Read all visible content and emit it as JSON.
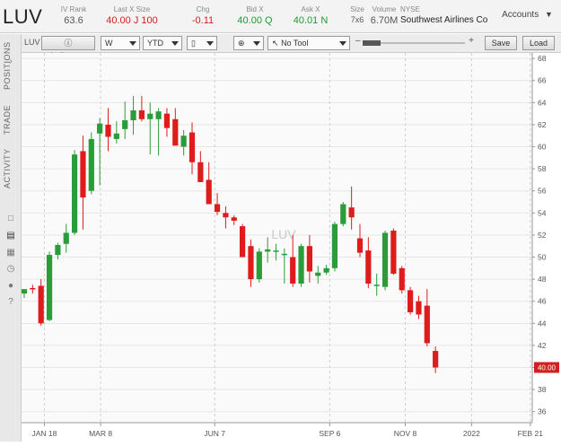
{
  "header": {
    "symbol": "LUV",
    "ivrank_label": "IV Rank",
    "ivrank_value": "63.6",
    "lastx_label": "Last X Size",
    "lastx_value": "40.00 J 100",
    "chg_label": "Chg",
    "chg_value": "-0.11",
    "bidx_label": "Bid X",
    "bidx_value": "40.00 Q",
    "askx_label": "Ask X",
    "askx_value": "40.01 N",
    "size_label": "Size",
    "size_value": "7x6",
    "volume_label": "Volume",
    "volume_value": "6.70M",
    "exchange": "NYSE",
    "company": "Southwest Airlines Co",
    "accounts_label": "Accounts"
  },
  "toolbar": {
    "symbol_label": "LUV",
    "indicators_label": "Indicators",
    "period": "W",
    "range": "YTD",
    "tool": "No Tool",
    "save_label": "Save",
    "load_label": "Load"
  },
  "sidebar": {
    "tabs": [
      "POSITIONS",
      "TRADE",
      "ACTIVITY"
    ]
  },
  "chart_data": {
    "type": "candlestick",
    "watermark": "LUV",
    "ylim": [
      35,
      68.5
    ],
    "yticks": [
      36,
      38,
      40,
      42,
      44,
      46,
      48,
      50,
      52,
      54,
      56,
      58,
      60,
      62,
      64,
      66,
      68
    ],
    "xticks": [
      "JAN 18",
      "MAR 8",
      "JUN 7",
      "SEP 6",
      "NOV 8",
      "2022",
      "FEB 21"
    ],
    "last_price_label": "40.00",
    "colors": {
      "up": "#2a9d3a",
      "down": "#e01b1b",
      "grid": "#e6e6e6"
    },
    "candles": [
      {
        "o": 46.7,
        "h": 47.1,
        "l": 46.3,
        "c": 47.1
      },
      {
        "o": 47.2,
        "h": 47.5,
        "l": 46.7,
        "c": 47.1
      },
      {
        "o": 47.4,
        "h": 48.0,
        "l": 43.8,
        "c": 44.0
      },
      {
        "o": 44.3,
        "h": 50.5,
        "l": 44.2,
        "c": 50.2
      },
      {
        "o": 50.2,
        "h": 51.3,
        "l": 49.8,
        "c": 51.1
      },
      {
        "o": 51.2,
        "h": 53.0,
        "l": 50.4,
        "c": 52.2
      },
      {
        "o": 52.2,
        "h": 59.7,
        "l": 52.0,
        "c": 59.3
      },
      {
        "o": 59.6,
        "h": 61.0,
        "l": 52.5,
        "c": 55.4
      },
      {
        "o": 56.0,
        "h": 61.3,
        "l": 55.7,
        "c": 60.7
      },
      {
        "o": 61.2,
        "h": 62.6,
        "l": 56.5,
        "c": 62.1
      },
      {
        "o": 62.0,
        "h": 63.5,
        "l": 59.6,
        "c": 60.9
      },
      {
        "o": 60.7,
        "h": 62.3,
        "l": 60.3,
        "c": 61.2
      },
      {
        "o": 61.6,
        "h": 64.1,
        "l": 60.7,
        "c": 62.4
      },
      {
        "o": 62.4,
        "h": 64.6,
        "l": 61.1,
        "c": 63.3
      },
      {
        "o": 63.3,
        "h": 64.6,
        "l": 62.3,
        "c": 62.5
      },
      {
        "o": 62.5,
        "h": 64.0,
        "l": 59.3,
        "c": 63.0
      },
      {
        "o": 62.5,
        "h": 63.5,
        "l": 59.2,
        "c": 63.2
      },
      {
        "o": 63.0,
        "h": 63.5,
        "l": 60.9,
        "c": 61.7
      },
      {
        "o": 62.5,
        "h": 63.5,
        "l": 60.3,
        "c": 60.1
      },
      {
        "o": 60.0,
        "h": 61.5,
        "l": 59.2,
        "c": 61.0
      },
      {
        "o": 61.3,
        "h": 62.2,
        "l": 57.5,
        "c": 58.6
      },
      {
        "o": 58.6,
        "h": 59.6,
        "l": 56.8,
        "c": 56.8
      },
      {
        "o": 57.0,
        "h": 58.6,
        "l": 54.8,
        "c": 54.8
      },
      {
        "o": 54.8,
        "h": 55.8,
        "l": 53.8,
        "c": 54.1
      },
      {
        "o": 54.0,
        "h": 54.6,
        "l": 52.6,
        "c": 53.6
      },
      {
        "o": 53.6,
        "h": 53.8,
        "l": 52.9,
        "c": 53.3
      },
      {
        "o": 52.8,
        "h": 53.0,
        "l": 50.0,
        "c": 50.0
      },
      {
        "o": 51.0,
        "h": 51.6,
        "l": 47.3,
        "c": 48.0
      },
      {
        "o": 48.0,
        "h": 50.8,
        "l": 47.7,
        "c": 50.5
      },
      {
        "o": 50.5,
        "h": 51.8,
        "l": 49.5,
        "c": 50.7
      },
      {
        "o": 50.6,
        "h": 51.2,
        "l": 49.7,
        "c": 50.6
      },
      {
        "o": 50.2,
        "h": 50.8,
        "l": 47.6,
        "c": 50.3
      },
      {
        "o": 50.0,
        "h": 52.0,
        "l": 47.3,
        "c": 47.6
      },
      {
        "o": 47.6,
        "h": 51.2,
        "l": 47.3,
        "c": 51.0
      },
      {
        "o": 51.0,
        "h": 52.0,
        "l": 47.7,
        "c": 48.7
      },
      {
        "o": 48.3,
        "h": 49.2,
        "l": 47.6,
        "c": 48.6
      },
      {
        "o": 48.6,
        "h": 49.3,
        "l": 48.4,
        "c": 49.0
      },
      {
        "o": 49.0,
        "h": 53.2,
        "l": 48.7,
        "c": 53.0
      },
      {
        "o": 53.0,
        "h": 55.0,
        "l": 52.8,
        "c": 54.8
      },
      {
        "o": 54.5,
        "h": 56.4,
        "l": 52.5,
        "c": 53.6
      },
      {
        "o": 51.7,
        "h": 53.0,
        "l": 50.0,
        "c": 50.4
      },
      {
        "o": 50.6,
        "h": 51.8,
        "l": 47.2,
        "c": 47.6
      },
      {
        "o": 47.5,
        "h": 48.5,
        "l": 46.5,
        "c": 47.5
      },
      {
        "o": 47.3,
        "h": 52.4,
        "l": 47.0,
        "c": 52.2
      },
      {
        "o": 52.4,
        "h": 52.6,
        "l": 48.4,
        "c": 48.5
      },
      {
        "o": 49.0,
        "h": 49.2,
        "l": 46.7,
        "c": 47.0
      },
      {
        "o": 47.0,
        "h": 47.3,
        "l": 44.8,
        "c": 45.0
      },
      {
        "o": 46.0,
        "h": 46.5,
        "l": 44.4,
        "c": 44.8
      },
      {
        "o": 45.6,
        "h": 47.1,
        "l": 41.9,
        "c": 42.2
      },
      {
        "o": 41.5,
        "h": 41.9,
        "l": 39.5,
        "c": 40.0
      }
    ]
  }
}
